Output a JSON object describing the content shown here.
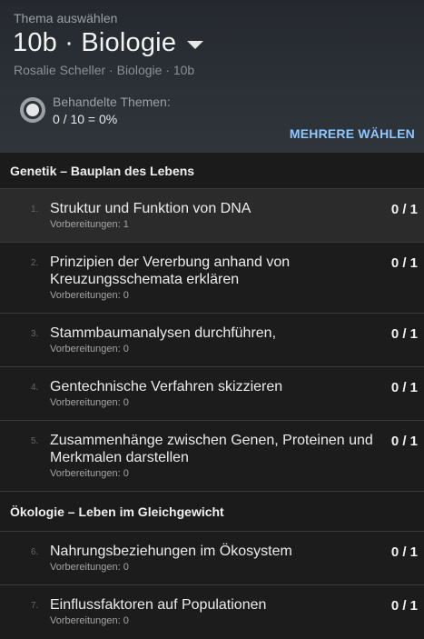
{
  "header": {
    "pre_label": "Thema auswählen",
    "title": "10b · Biologie",
    "subtitle": "Rosalie Scheller · Biologie · 10b",
    "progress_label": "Behandelte Themen:",
    "progress_value": "0 / 10 = 0%",
    "progress_fraction": 0,
    "multi_select_label": "MEHRERE WÄHLEN"
  },
  "colors": {
    "accent": "#8ec8ff",
    "background": "#1b1b1b",
    "header_bg": "#2c3036",
    "active_row": "#2b2b2b"
  },
  "sections": [
    {
      "title": "Genetik – Bauplan des Lebens",
      "items": [
        {
          "num": "1.",
          "name": "Struktur und Funktion von DNA",
          "prep": "Vorbereitungen: 1",
          "score": "0 / 1",
          "active": true
        },
        {
          "num": "2.",
          "name": "Prinzipien der Vererbung anhand von Kreuzungsschemata erklären",
          "prep": "Vorbereitungen: 0",
          "score": "0 / 1"
        },
        {
          "num": "3.",
          "name": "Stammbaumanalysen durchführen,",
          "prep": "Vorbereitungen: 0",
          "score": "0 / 1"
        },
        {
          "num": "4.",
          "name": "Gentechnische Verfahren skizzieren",
          "prep": "Vorbereitungen: 0",
          "score": "0 / 1"
        },
        {
          "num": "5.",
          "name": "Zusammenhänge zwischen Genen, Proteinen und Merkmalen darstellen",
          "prep": "Vorbereitungen: 0",
          "score": "0 / 1"
        }
      ]
    },
    {
      "title": "Ökologie – Leben im Gleichgewicht",
      "items": [
        {
          "num": "6.",
          "name": "Nahrungsbeziehungen im Ökosystem",
          "prep": "Vorbereitungen: 0",
          "score": "0 / 1"
        },
        {
          "num": "7.",
          "name": "Einflussfaktoren auf Populationen",
          "prep": "Vorbereitungen: 0",
          "score": "0 / 1"
        }
      ]
    }
  ]
}
